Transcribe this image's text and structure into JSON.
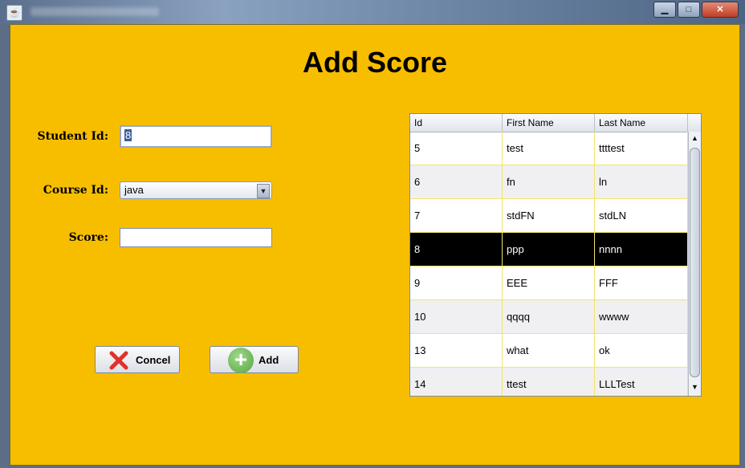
{
  "window": {
    "title_icon": "java-cup-icon",
    "minimize": "▁",
    "maximize": "□",
    "close": "✕"
  },
  "page_title": "Add Score",
  "form": {
    "student_label": "Student Id:",
    "student_value": "8",
    "course_label": "Course Id:",
    "course_value": "java",
    "score_label": "Score:",
    "score_value": ""
  },
  "buttons": {
    "cancel": "Concel",
    "add": "Add"
  },
  "table": {
    "columns": [
      "Id",
      "First Name",
      "Last Name"
    ],
    "rows": [
      [
        "5",
        "test",
        "ttttest"
      ],
      [
        "6",
        "fn",
        "ln"
      ],
      [
        "7",
        "stdFN",
        "stdLN"
      ],
      [
        "8",
        "ppp",
        "nnnn"
      ],
      [
        "9",
        "EEE",
        "FFF"
      ],
      [
        "10",
        "qqqq",
        "wwww"
      ],
      [
        "13",
        "what",
        "ok"
      ],
      [
        "14",
        "ttest",
        "LLLTest"
      ]
    ],
    "selected_row": 3
  },
  "colors": {
    "background": "#f7be00",
    "selected_row": "#000000",
    "cancel_x": "#e0322a",
    "add_plus": "#57a63e"
  }
}
